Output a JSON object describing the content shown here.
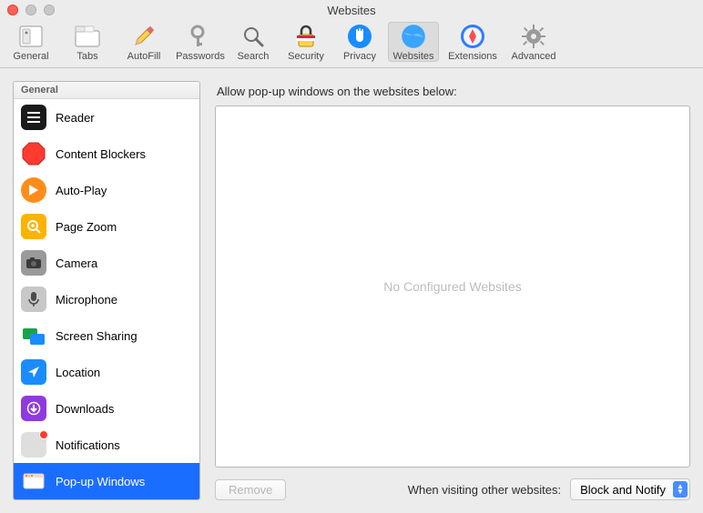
{
  "window": {
    "title": "Websites"
  },
  "toolbar": [
    {
      "label": "General"
    },
    {
      "label": "Tabs"
    },
    {
      "label": "AutoFill"
    },
    {
      "label": "Passwords"
    },
    {
      "label": "Search"
    },
    {
      "label": "Security"
    },
    {
      "label": "Privacy"
    },
    {
      "label": "Websites"
    },
    {
      "label": "Extensions"
    },
    {
      "label": "Advanced"
    }
  ],
  "sidebar": {
    "header": "General",
    "items": [
      {
        "label": "Reader"
      },
      {
        "label": "Content Blockers"
      },
      {
        "label": "Auto-Play"
      },
      {
        "label": "Page Zoom"
      },
      {
        "label": "Camera"
      },
      {
        "label": "Microphone"
      },
      {
        "label": "Screen Sharing"
      },
      {
        "label": "Location"
      },
      {
        "label": "Downloads"
      },
      {
        "label": "Notifications"
      },
      {
        "label": "Pop-up Windows"
      }
    ]
  },
  "main": {
    "heading": "Allow pop-up windows on the websites below:",
    "empty_text": "No Configured Websites",
    "remove_label": "Remove",
    "other_label": "When visiting other websites:",
    "select_value": "Block and Notify"
  }
}
